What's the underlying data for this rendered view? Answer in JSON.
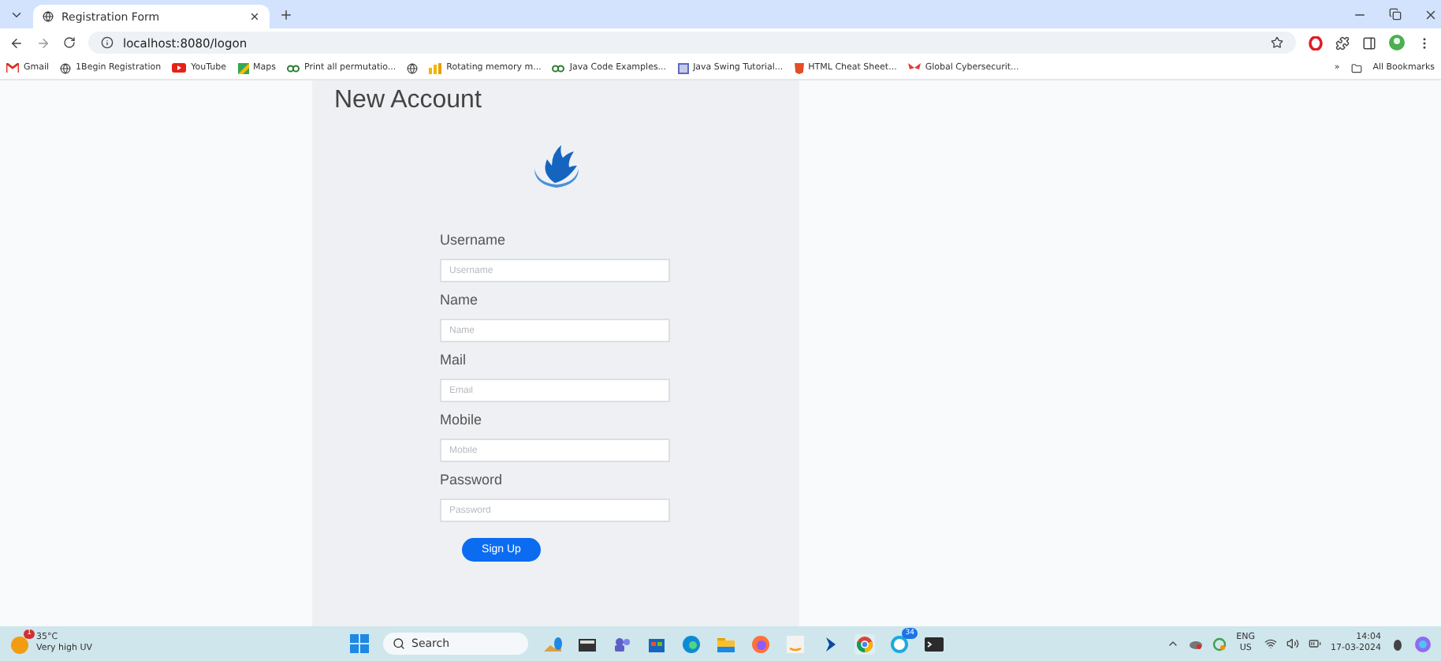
{
  "tabs": [
    {
      "title": "Registration Form",
      "selected": true
    }
  ],
  "address": "localhost:8080/logon",
  "bookmarks": [
    {
      "label": "Gmail",
      "kind": "mail"
    },
    {
      "label": "1Begin Registration",
      "kind": "globe"
    },
    {
      "label": "YouTube",
      "kind": "video"
    },
    {
      "label": "Maps",
      "kind": "map"
    },
    {
      "label": "Print all permutatio...",
      "kind": "link"
    },
    {
      "kind": "globe"
    },
    {
      "label": "Rotating memory m...",
      "kind": "chart"
    },
    {
      "label": "Java Code Examples...",
      "kind": "link"
    },
    {
      "label": "Java Swing Tutorial...",
      "kind": "book"
    },
    {
      "label": "HTML Cheat Sheet...",
      "kind": "html"
    },
    {
      "label": "Global Cybersecurit...",
      "kind": "shield"
    }
  ],
  "bookmarks_overflow": "»",
  "all_bookmarks": "All Bookmarks",
  "form": {
    "title": "New Account",
    "fields": [
      {
        "label": "Username",
        "placeholder": "Username"
      },
      {
        "label": "Name",
        "placeholder": "Name"
      },
      {
        "label": "Mail",
        "placeholder": "Email"
      },
      {
        "label": "Mobile",
        "placeholder": "Mobile"
      },
      {
        "label": "Password",
        "placeholder": "Password"
      }
    ],
    "submit": "Sign Up"
  },
  "taskbar": {
    "weather": {
      "temp": "35°C",
      "desc": "Very high UV",
      "badge": "1"
    },
    "search": {
      "placeholder": "Search"
    },
    "apps": [
      {
        "kind": "widgets"
      },
      {
        "kind": "files"
      },
      {
        "kind": "teams"
      },
      {
        "kind": "store"
      },
      {
        "kind": "edge"
      },
      {
        "kind": "folder"
      },
      {
        "kind": "firefox"
      },
      {
        "kind": "amazon"
      },
      {
        "kind": "arrow"
      },
      {
        "kind": "chrome"
      },
      {
        "kind": "whatsapp",
        "badge": "34"
      },
      {
        "kind": "terminal"
      }
    ],
    "language": "ENG",
    "region": "US",
    "time": "14:04",
    "date": "17-03-2024"
  }
}
